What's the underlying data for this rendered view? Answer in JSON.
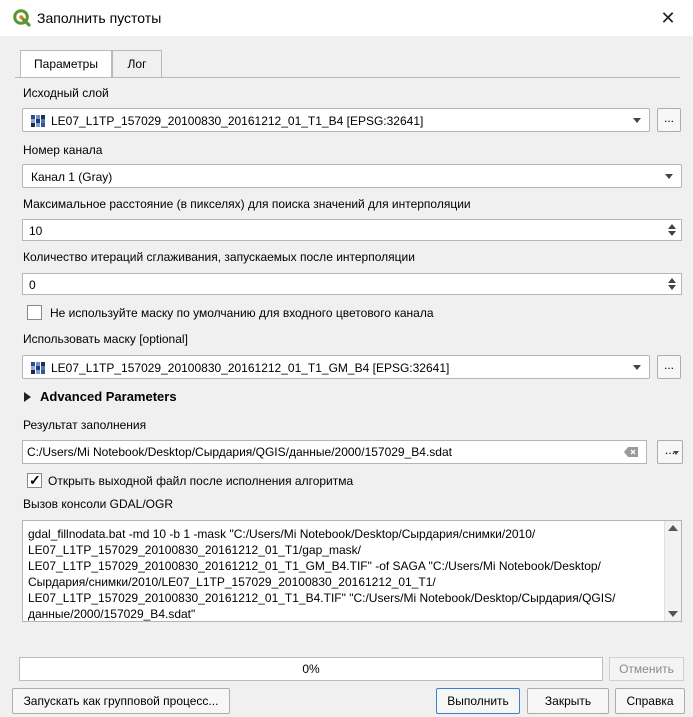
{
  "window": {
    "title": "Заполнить пустоты",
    "close_glyph": "✕",
    "icon": "qgis-logo-icon"
  },
  "tabs": [
    {
      "label": "Параметры",
      "active": true
    },
    {
      "label": "Лог",
      "active": false
    }
  ],
  "params": {
    "input_layer_label": "Исходный слой",
    "input_layer_value": "LE07_L1TP_157029_20100830_20161212_01_T1_B4 [EPSG:32641]",
    "band_label": "Номер канала",
    "band_value": "Канал 1 (Gray)",
    "distance_label": "Максимальное расстояние (в пикселях) для поиска значений для интерполяции",
    "distance_value": "10",
    "iterations_label": "Количество итераций сглаживания, запускаемых после интерполяции",
    "iterations_value": "0",
    "no_mask_label": "Не используйте маску по умолчанию для входного цветового канала",
    "no_mask_checked": false,
    "mask_label": "Использовать маску [optional]",
    "mask_value": "LE07_L1TP_157029_20100830_20161212_01_T1_GM_B4 [EPSG:32641]",
    "advanced_label": "Advanced Parameters",
    "output_label": "Результат заполнения",
    "output_value": "C:/Users/Mi Notebook/Desktop/Сырдария/QGIS/данные/2000/157029_B4.sdat",
    "open_output_label": "Открыть выходной файл после исполнения алгоритма",
    "open_output_checked": true,
    "console_label": "Вызов консоли GDAL/OGR",
    "console_text": "gdal_fillnodata.bat -md 10 -b 1 -mask \"C:/Users/Mi Notebook/Desktop/Сырдария/снимки/2010/\nLE07_L1TP_157029_20100830_20161212_01_T1/gap_mask/\nLE07_L1TP_157029_20100830_20161212_01_T1_GM_B4.TIF\" -of SAGA \"C:/Users/Mi Notebook/Desktop/\nСырдария/снимки/2010/LE07_L1TP_157029_20100830_20161212_01_T1/\nLE07_L1TP_157029_20100830_20161212_01_T1_B4.TIF\" \"C:/Users/Mi Notebook/Desktop/Сырдария/QGIS/\nданные/2000/157029_B4.sdat\""
  },
  "buttons": {
    "browse": "...",
    "cancel": "Отменить",
    "batch": "Запускать как групповой процесс...",
    "run": "Выполнить",
    "close": "Закрыть",
    "help": "Справка"
  },
  "progress": {
    "text": "0%",
    "value": 0
  },
  "colors": {
    "accent": "#3c7fd1",
    "qgis_green": "#589632",
    "qgis_yellow": "#ee7913"
  }
}
